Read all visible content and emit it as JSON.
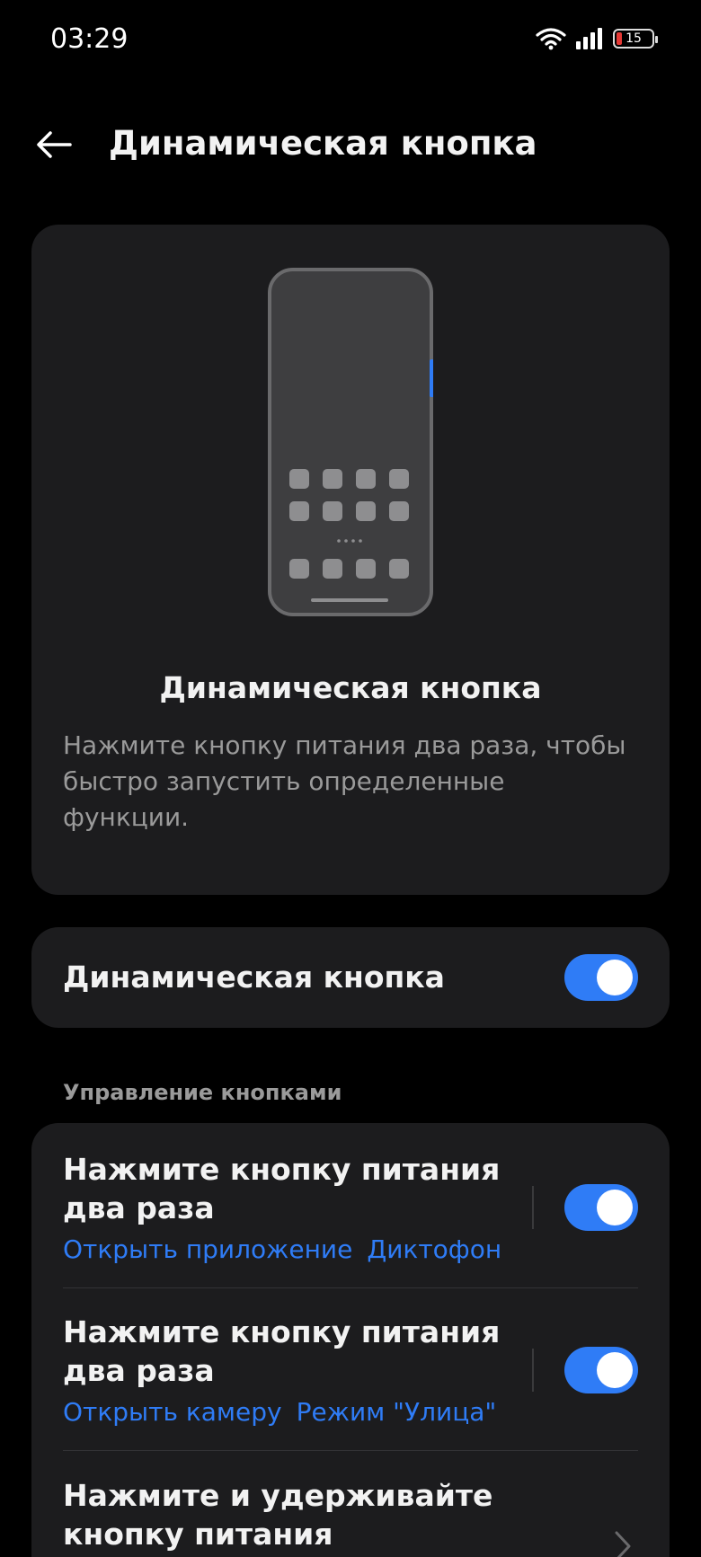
{
  "status_bar": {
    "time": "03:29",
    "battery_level": "15",
    "icons": [
      "wifi-icon",
      "signal-icon",
      "battery-icon"
    ]
  },
  "header": {
    "title": "Динамическая кнопка",
    "back_icon": "arrow-left-icon"
  },
  "hero": {
    "title": "Динамическая кнопка",
    "description": "Нажмите кнопку питания два раза, чтобы быстро запустить определенные функции."
  },
  "main_toggle": {
    "label": "Динамическая кнопка",
    "enabled": true
  },
  "section": {
    "header": "Управление кнопками"
  },
  "items": [
    {
      "title": "Нажмите кнопку питания два раза",
      "action": "Открыть приложение",
      "target": "Диктофон",
      "enabled": true
    },
    {
      "title": "Нажмите кнопку питания два раза",
      "action": "Открыть камеру",
      "target": "Режим \"Улица\"",
      "enabled": true
    },
    {
      "title": "Нажмите и удерживайте кнопку питания"
    }
  ],
  "colors": {
    "accent": "#2f7cf6",
    "card": "#1c1c1e",
    "background": "#000000",
    "secondary_text": "#9a9a9a"
  }
}
